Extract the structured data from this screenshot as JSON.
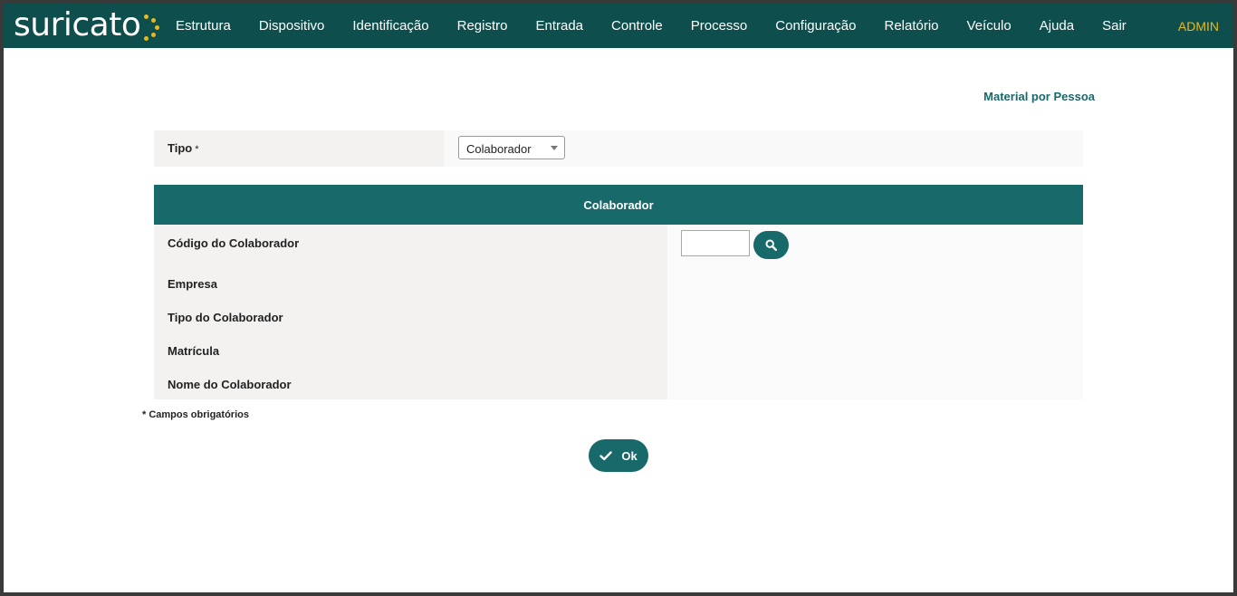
{
  "brand": {
    "logo_text": "suricato",
    "accent_color": "#e9b91c",
    "nav_bg_color": "#0e4f4d",
    "primary_color": "#17696a"
  },
  "nav": {
    "items": [
      {
        "label": "Estrutura"
      },
      {
        "label": "Dispositivo"
      },
      {
        "label": "Identificação"
      },
      {
        "label": "Registro"
      },
      {
        "label": "Entrada"
      },
      {
        "label": "Controle"
      },
      {
        "label": "Processo"
      },
      {
        "label": "Configuração"
      },
      {
        "label": "Relatório"
      },
      {
        "label": "Veículo"
      },
      {
        "label": "Ajuda"
      },
      {
        "label": "Sair"
      }
    ],
    "user_label": "ADMIN"
  },
  "page": {
    "title": "Material por Pessoa"
  },
  "form": {
    "tipo_label": "Tipo",
    "required_marker": "*",
    "tipo_selected": "Colaborador",
    "panel_title": "Colaborador",
    "fields": {
      "codigo": "Código do Colaborador",
      "empresa": "Empresa",
      "tipo_colaborador": "Tipo do Colaborador",
      "matricula": "Matrícula",
      "nome": "Nome do Colaborador"
    },
    "codigo_value": "",
    "search_icon": "search-icon",
    "required_note": "* Campos obrigatórios",
    "ok_label": "Ok",
    "ok_icon": "check-icon"
  }
}
